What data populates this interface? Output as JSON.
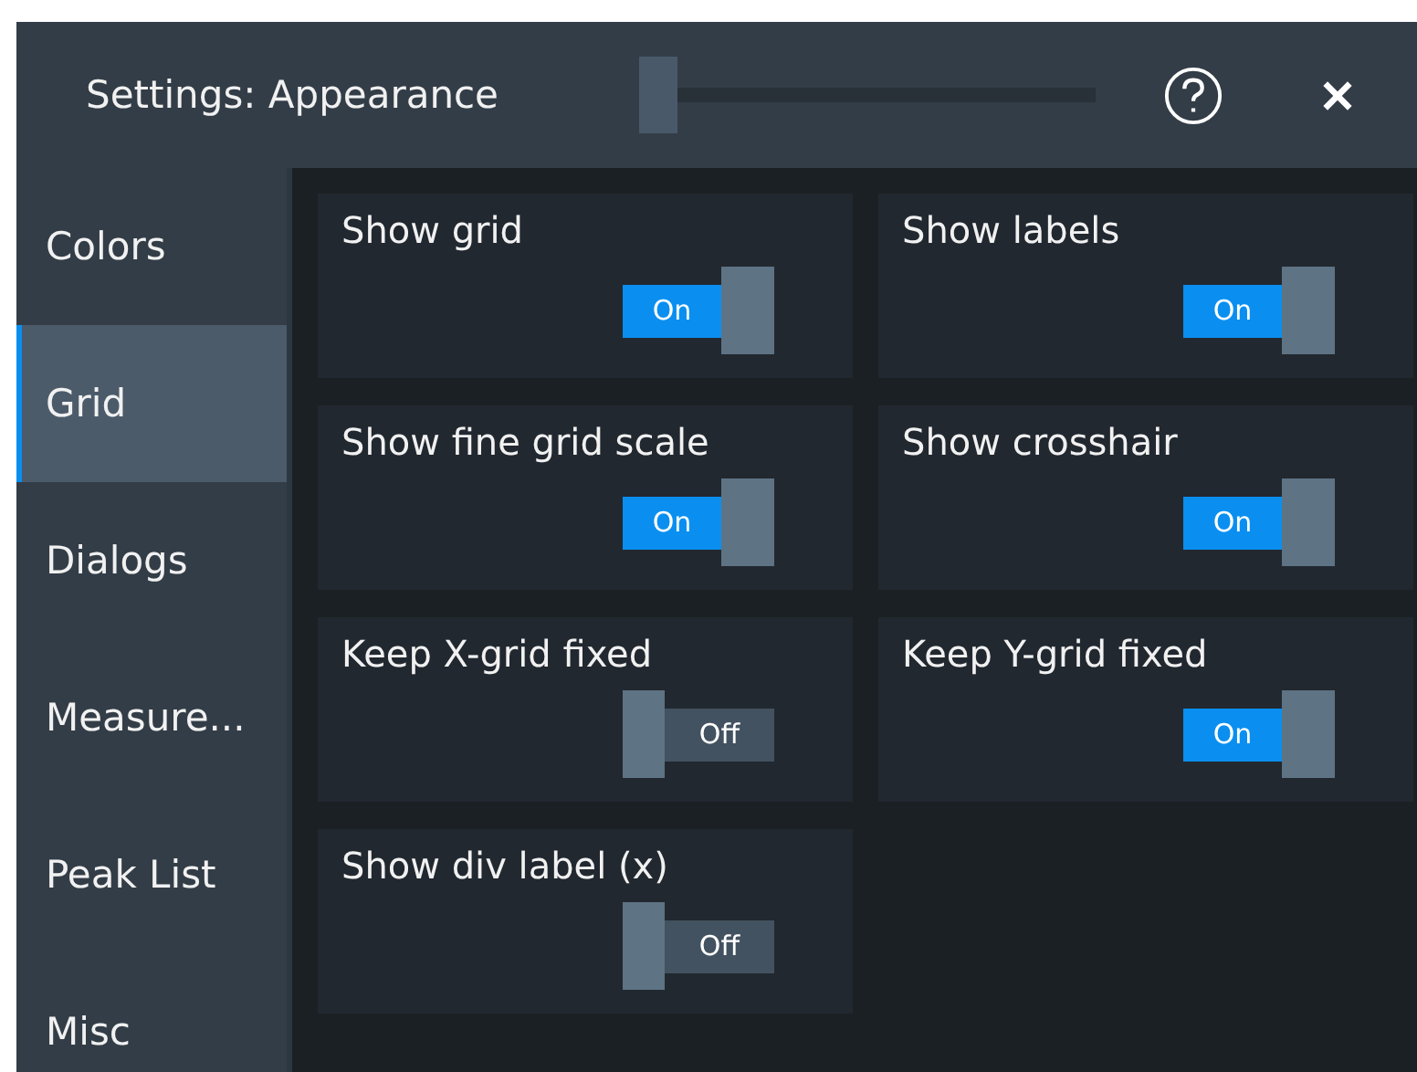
{
  "window": {
    "title": "Settings: Appearance"
  },
  "title_slider": {
    "level": 0
  },
  "sidebar": {
    "items": [
      {
        "label": "Colors",
        "selected": false
      },
      {
        "label": "Grid",
        "selected": true
      },
      {
        "label": "Dialogs",
        "selected": false
      },
      {
        "label": "Measure...",
        "selected": false
      },
      {
        "label": "Peak List",
        "selected": false
      },
      {
        "label": "Misc",
        "selected": false
      }
    ]
  },
  "settings": [
    {
      "label": "Show grid",
      "on": true,
      "state_text": "On"
    },
    {
      "label": "Show labels",
      "on": true,
      "state_text": "On"
    },
    {
      "label": "Show fine grid scale",
      "on": true,
      "state_text": "On"
    },
    {
      "label": "Show crosshair",
      "on": true,
      "state_text": "On"
    },
    {
      "label": "Keep X-grid fixed",
      "on": false,
      "state_text": "Off"
    },
    {
      "label": "Keep Y-grid fixed",
      "on": true,
      "state_text": "On"
    },
    {
      "label": "Show div label (x)",
      "on": false,
      "state_text": "Off"
    }
  ]
}
